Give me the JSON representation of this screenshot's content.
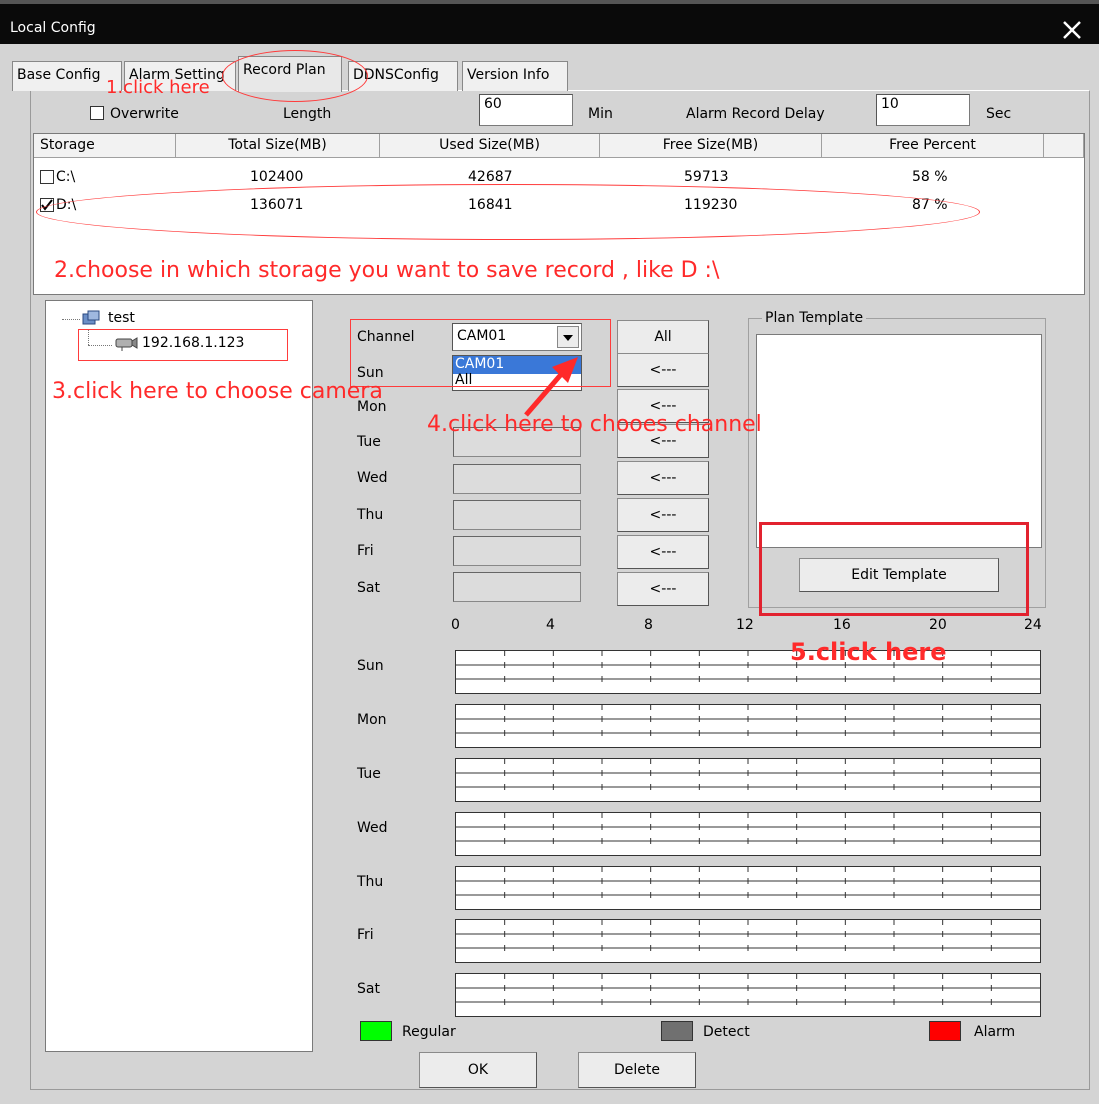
{
  "window": {
    "title": "Local Config",
    "close_glyph": "✕"
  },
  "tabs": [
    {
      "label": "Base Config"
    },
    {
      "label": "Alarm Setting"
    },
    {
      "label": "Record Plan",
      "active": true
    },
    {
      "label": "DDNSConfig"
    },
    {
      "label": "Version Info"
    }
  ],
  "record": {
    "overwrite_label": "Overwrite",
    "overwrite_checked": false,
    "length_label": "Length",
    "length_value": "60",
    "length_unit": "Min",
    "alarm_delay_label": "Alarm Record Delay",
    "alarm_delay_value": "10",
    "alarm_delay_unit": "Sec"
  },
  "storage": {
    "columns": [
      "Storage",
      "Total Size(MB)",
      "Used Size(MB)",
      "Free Size(MB)",
      "Free Percent"
    ],
    "rows": [
      {
        "drive": "C:\\",
        "checked": false,
        "total": "102400",
        "used": "42687",
        "free": "59713",
        "percent": "58 %"
      },
      {
        "drive": "D:\\",
        "checked": true,
        "total": "136071",
        "used": "16841",
        "free": "119230",
        "percent": "87 %"
      }
    ]
  },
  "annotations": {
    "step1": "1.click here",
    "step2": "2.choose in which storage you want to save record , like D :\\",
    "step3": "3.click here to choose camera",
    "step4": "4.click here to chooes channel",
    "step5": "5.click here"
  },
  "tree": {
    "root_label": "test",
    "device_label": "192.168.1.123"
  },
  "channel": {
    "label": "Channel",
    "selected": "CAM01",
    "options": [
      "CAM01",
      "All"
    ],
    "all_button": "All"
  },
  "days": [
    "Sun",
    "Mon",
    "Tue",
    "Wed",
    "Thu",
    "Fri",
    "Sat"
  ],
  "copy_button": "<---",
  "plan_template": {
    "label": "Plan Template",
    "edit_button": "Edit Template"
  },
  "timeline": {
    "ticks": [
      "0",
      "4",
      "8",
      "12",
      "16",
      "20",
      "24"
    ]
  },
  "legend": [
    {
      "label": "Regular",
      "color": "#00ff00"
    },
    {
      "label": "Detect",
      "color": "#707070"
    },
    {
      "label": "Alarm",
      "color": "#ff0000"
    }
  ],
  "buttons": {
    "ok": "OK",
    "delete": "Delete"
  }
}
